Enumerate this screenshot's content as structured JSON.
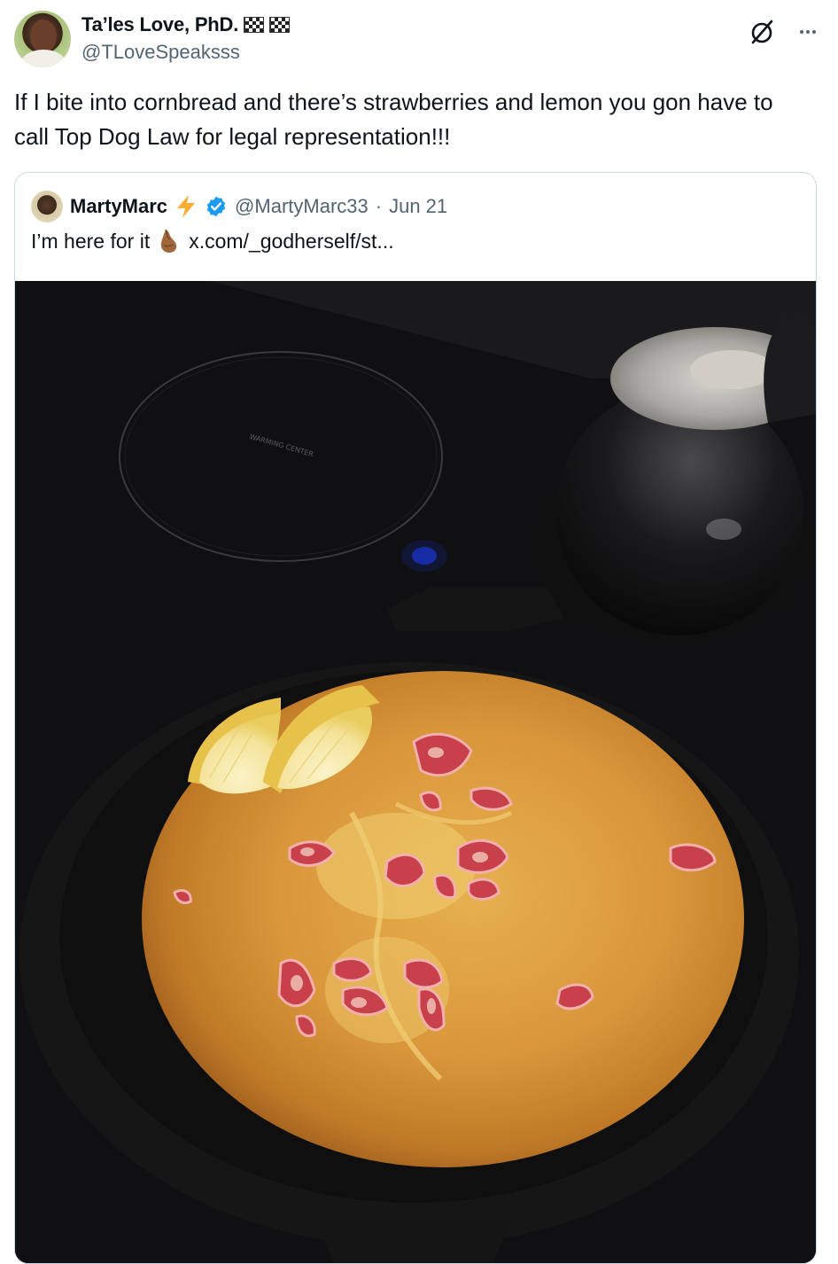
{
  "tweet": {
    "author": {
      "display_name": "Ta’les Love, PhD.",
      "flags": [
        "chequered-flag",
        "chequered-flag"
      ],
      "handle": "@TLoveSpeaksss"
    },
    "text": "If I bite into cornbread and there’s strawberries and lemon  you gon have to call Top Dog Law for legal representation!!!"
  },
  "quote": {
    "author": {
      "display_name": "MartyMarc",
      "badge_icon": "lightning-bolt",
      "verified": true,
      "handle": "@MartyMarc33",
      "separator": "·",
      "date": "Jun 21"
    },
    "text": "I’m here for it",
    "emoji": "pinched-fingers",
    "link": "x.com/_godherself/st..."
  },
  "photo": {
    "stove_label": "WARMING CENTER"
  },
  "colors": {
    "text_primary": "#0f1419",
    "text_secondary": "#536471",
    "border": "#cfd9de",
    "verified_blue": "#1d9bf0",
    "bolt_yellow": "#ffac33"
  }
}
